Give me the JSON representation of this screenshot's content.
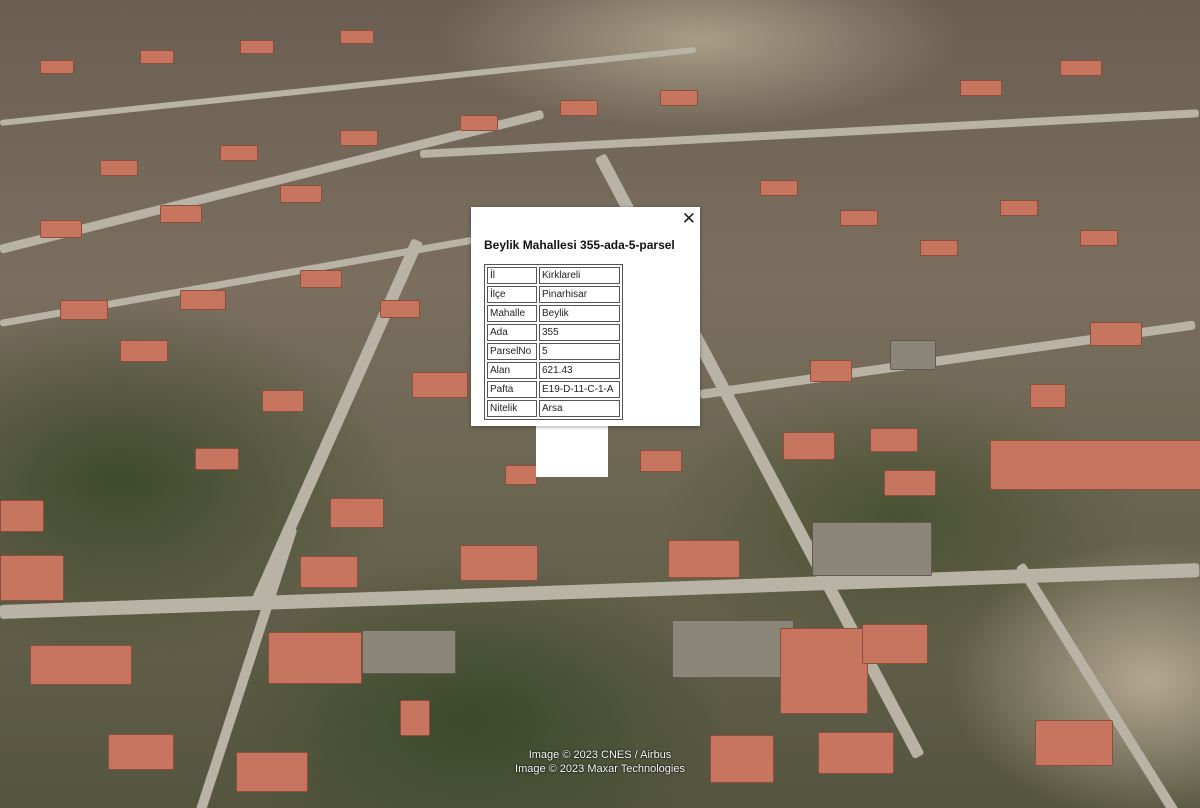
{
  "popup": {
    "title": "Beylik Mahallesi 355-ada-5-parsel",
    "close_symbol": "✕",
    "rows": [
      {
        "key": "İl",
        "value": "Kirklareli"
      },
      {
        "key": "İlçe",
        "value": "Pinarhisar"
      },
      {
        "key": "Mahalle",
        "value": "Beylik"
      },
      {
        "key": "Ada",
        "value": "355"
      },
      {
        "key": "ParselNo",
        "value": "5"
      },
      {
        "key": "Alan",
        "value": "621.43"
      },
      {
        "key": "Pafta",
        "value": "E19-D-11-C-1-A"
      },
      {
        "key": "Nitelik",
        "value": "Arsa"
      }
    ]
  },
  "attribution": {
    "line1": "Image © 2023 CNES / Airbus",
    "line2": "Image © 2023 Maxar Technologies"
  }
}
